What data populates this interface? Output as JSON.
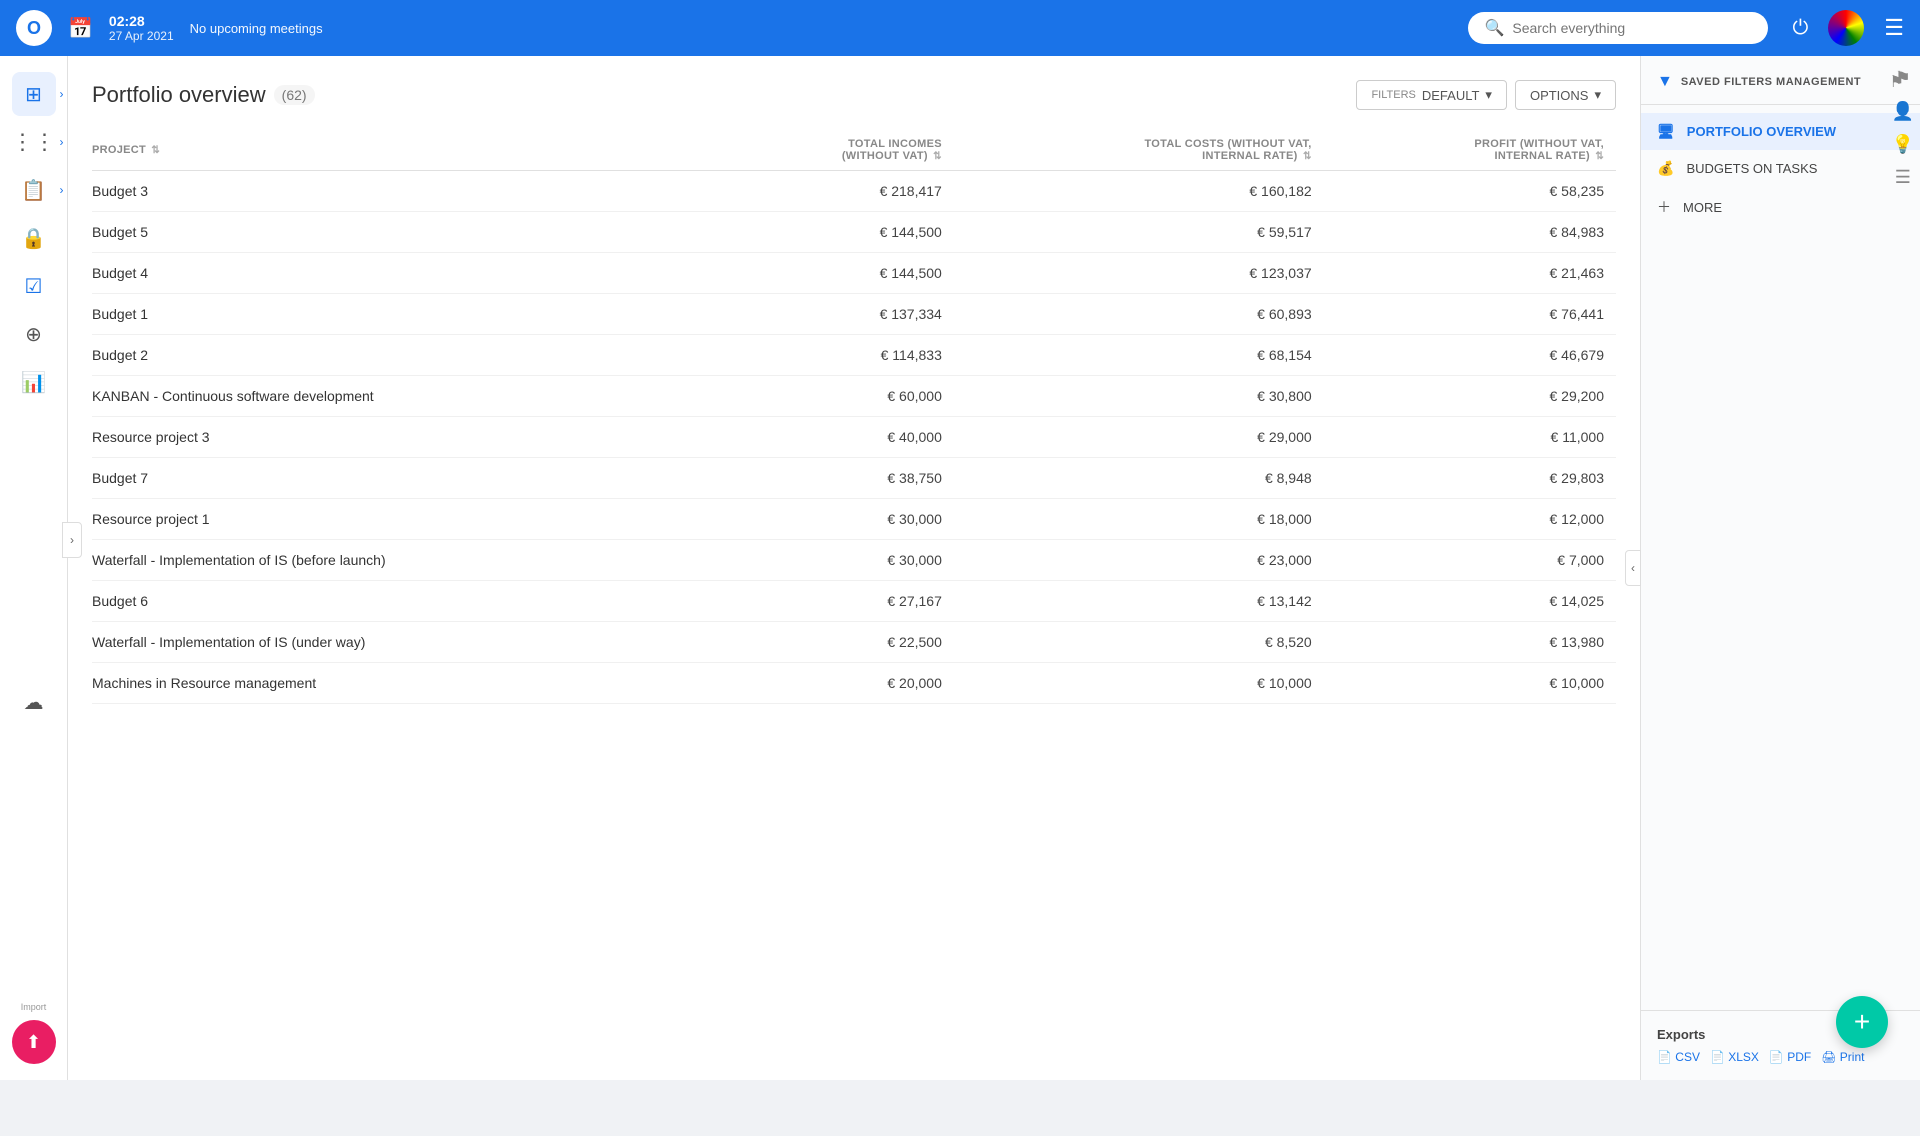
{
  "topnav": {
    "logo": "O",
    "time": "02:28",
    "date": "27 Apr 2021",
    "meeting": "No upcoming meetings",
    "search_placeholder": "Search everything"
  },
  "sidebar": {
    "items": [
      {
        "id": "dashboard",
        "icon": "⊞",
        "label": "Dashboard",
        "active": true,
        "expandable": true
      },
      {
        "id": "tasks",
        "icon": "⋮",
        "label": "Tasks",
        "expandable": true
      },
      {
        "id": "notes",
        "icon": "📋",
        "label": "Notes",
        "expandable": true
      },
      {
        "id": "lock",
        "icon": "🔒",
        "label": "Lock"
      },
      {
        "id": "check",
        "icon": "✓",
        "label": "Check",
        "active": false
      },
      {
        "id": "goal",
        "icon": "⊕",
        "label": "Goal"
      },
      {
        "id": "analytics",
        "icon": "📊",
        "label": "Analytics"
      },
      {
        "id": "cloud",
        "icon": "☁",
        "label": "Cloud"
      }
    ],
    "import_label": "Import"
  },
  "page": {
    "title": "Portfolio overview",
    "count": "62",
    "filters_label": "FILTERS",
    "filters_value": "DEFAULT",
    "options_label": "OPTIONS"
  },
  "table": {
    "columns": [
      {
        "id": "project",
        "label": "PROJECT",
        "sortable": true
      },
      {
        "id": "total_incomes",
        "label": "TOTAL INCOMES (WITHOUT VAT)",
        "sortable": true,
        "align": "right"
      },
      {
        "id": "total_costs",
        "label": "TOTAL COSTS (WITHOUT VAT, INTERNAL RATE)",
        "sortable": true,
        "align": "right"
      },
      {
        "id": "profit",
        "label": "PROFIT (WITHOUT VAT, INTERNAL RATE)",
        "sortable": true,
        "align": "right"
      }
    ],
    "rows": [
      {
        "project": "Budget 3",
        "total_incomes": "€ 218,417",
        "total_costs": "€ 160,182",
        "profit": "€ 58,235"
      },
      {
        "project": "Budget 5",
        "total_incomes": "€ 144,500",
        "total_costs": "€ 59,517",
        "profit": "€ 84,983"
      },
      {
        "project": "Budget 4",
        "total_incomes": "€ 144,500",
        "total_costs": "€ 123,037",
        "profit": "€ 21,463"
      },
      {
        "project": "Budget 1",
        "total_incomes": "€ 137,334",
        "total_costs": "€ 60,893",
        "profit": "€ 76,441"
      },
      {
        "project": "Budget 2",
        "total_incomes": "€ 114,833",
        "total_costs": "€ 68,154",
        "profit": "€ 46,679"
      },
      {
        "project": "KANBAN - Continuous software development",
        "total_incomes": "€ 60,000",
        "total_costs": "€ 30,800",
        "profit": "€ 29,200"
      },
      {
        "project": "Resource project 3",
        "total_incomes": "€ 40,000",
        "total_costs": "€ 29,000",
        "profit": "€ 11,000"
      },
      {
        "project": "Budget 7",
        "total_incomes": "€ 38,750",
        "total_costs": "€ 8,948",
        "profit": "€ 29,803"
      },
      {
        "project": "Resource project 1",
        "total_incomes": "€ 30,000",
        "total_costs": "€ 18,000",
        "profit": "€ 12,000"
      },
      {
        "project": "Waterfall - Implementation of IS (before launch)",
        "total_incomes": "€ 30,000",
        "total_costs": "€ 23,000",
        "profit": "€ 7,000"
      },
      {
        "project": "Budget 6",
        "total_incomes": "€ 27,167",
        "total_costs": "€ 13,142",
        "profit": "€ 14,025"
      },
      {
        "project": "Waterfall - Implementation of IS (under way)",
        "total_incomes": "€ 22,500",
        "total_costs": "€ 8,520",
        "profit": "€ 13,980"
      },
      {
        "project": "Machines in Resource management",
        "total_incomes": "€ 20,000",
        "total_costs": "€ 10,000",
        "profit": "€ 10,000"
      }
    ]
  },
  "right_panel": {
    "title": "SAVED FILTERS MANAGEMENT",
    "nav_items": [
      {
        "id": "portfolio_overview",
        "label": "PORTFOLIO OVERVIEW",
        "icon": "🖥",
        "active": true
      },
      {
        "id": "budgets_on_tasks",
        "label": "BUDGETS ON TASKS",
        "icon": "💰"
      },
      {
        "id": "more",
        "label": "MORE",
        "icon": "+"
      }
    ],
    "exports": {
      "label": "Exports",
      "links": [
        "CSV",
        "XLSX",
        "PDF",
        "Print"
      ]
    }
  },
  "fab": {
    "label": "+"
  }
}
